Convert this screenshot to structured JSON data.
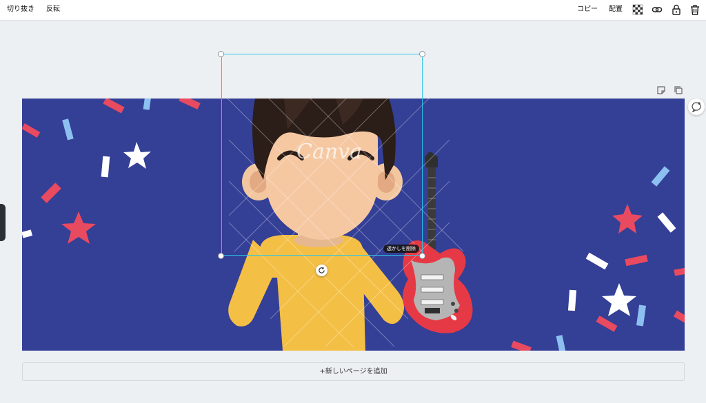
{
  "toolbar": {
    "crop_label": "切り抜き",
    "flip_label": "反転",
    "copy_label": "コピー",
    "arrange_label": "配置",
    "icons": [
      "transparency-icon",
      "link-icon",
      "lock-icon",
      "trash-icon"
    ]
  },
  "page": {
    "background_color": "#343f96",
    "add_page_label": "+新しいページを追加"
  },
  "selection": {
    "remove_watermark_label": "透かしを削除"
  },
  "watermark": {
    "text": "Canva"
  }
}
